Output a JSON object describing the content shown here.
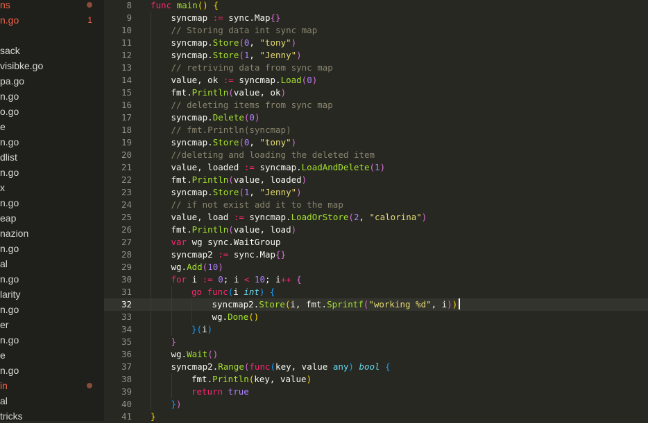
{
  "sidebar": {
    "items": [
      {
        "label": "ns"
      },
      {
        "label": "n.go",
        "badge": "1"
      },
      {
        "label": "sack"
      },
      {
        "label": "visibke.go"
      },
      {
        "label": "pa.go"
      },
      {
        "label": "n.go"
      },
      {
        "label": "o.go"
      },
      {
        "label": "e"
      },
      {
        "label": "n.go"
      },
      {
        "label": "dlist"
      },
      {
        "label": "n.go"
      },
      {
        "label": "x"
      },
      {
        "label": "n.go"
      },
      {
        "label": "eap"
      },
      {
        "label": "nazion"
      },
      {
        "label": "n.go"
      },
      {
        "label": "al"
      },
      {
        "label": "n.go"
      },
      {
        "label": "larity"
      },
      {
        "label": "n.go"
      },
      {
        "label": "er"
      },
      {
        "label": "n.go"
      },
      {
        "label": "e"
      },
      {
        "label": "n.go"
      },
      {
        "label": "in"
      },
      {
        "label": "al"
      },
      {
        "label": "tricks"
      }
    ]
  },
  "editor": {
    "current_line": 32,
    "lines": [
      {
        "n": "8",
        "indent": 0,
        "tokens": [
          [
            "kw",
            "func"
          ],
          [
            "",
            ""
          ],
          [
            "fn",
            " main"
          ],
          [
            "br1",
            "()"
          ],
          [
            "",
            ""
          ],
          [
            "br1",
            " {"
          ]
        ]
      },
      {
        "n": "9",
        "indent": 1,
        "tokens": [
          [
            "",
            "syncmap "
          ],
          [
            "op",
            ":="
          ],
          [
            "",
            " sync.Map"
          ],
          [
            "br2",
            "{}"
          ]
        ]
      },
      {
        "n": "10",
        "indent": 1,
        "tokens": [
          [
            "cm",
            "// Storing data int sync map"
          ]
        ]
      },
      {
        "n": "11",
        "indent": 1,
        "tokens": [
          [
            "",
            "syncmap."
          ],
          [
            "fn",
            "Store"
          ],
          [
            "br2",
            "("
          ],
          [
            "num",
            "0"
          ],
          [
            "",
            ", "
          ],
          [
            "str",
            "\"tony\""
          ],
          [
            "br2",
            ")"
          ]
        ]
      },
      {
        "n": "12",
        "indent": 1,
        "tokens": [
          [
            "",
            "syncmap."
          ],
          [
            "fn",
            "Store"
          ],
          [
            "br2",
            "("
          ],
          [
            "num",
            "1"
          ],
          [
            "",
            ", "
          ],
          [
            "str",
            "\"Jenny\""
          ],
          [
            "br2",
            ")"
          ]
        ]
      },
      {
        "n": "13",
        "indent": 1,
        "tokens": [
          [
            "cm",
            "// retriving data from sync map"
          ]
        ]
      },
      {
        "n": "14",
        "indent": 1,
        "tokens": [
          [
            "",
            "value, ok "
          ],
          [
            "op",
            ":="
          ],
          [
            "",
            " syncmap."
          ],
          [
            "fn",
            "Load"
          ],
          [
            "br2",
            "("
          ],
          [
            "num",
            "0"
          ],
          [
            "br2",
            ")"
          ]
        ]
      },
      {
        "n": "15",
        "indent": 1,
        "tokens": [
          [
            "",
            "fmt."
          ],
          [
            "fn",
            "Println"
          ],
          [
            "br2",
            "("
          ],
          [
            "",
            "value, ok"
          ],
          [
            "br2",
            ")"
          ]
        ]
      },
      {
        "n": "16",
        "indent": 1,
        "tokens": [
          [
            "cm",
            "// deleting items from sync map"
          ]
        ]
      },
      {
        "n": "17",
        "indent": 1,
        "tokens": [
          [
            "",
            "syncmap."
          ],
          [
            "fn",
            "Delete"
          ],
          [
            "br2",
            "("
          ],
          [
            "num",
            "0"
          ],
          [
            "br2",
            ")"
          ]
        ]
      },
      {
        "n": "18",
        "indent": 1,
        "tokens": [
          [
            "cm",
            "// fmt.Println(syncmap)"
          ]
        ]
      },
      {
        "n": "19",
        "indent": 1,
        "tokens": [
          [
            "",
            "syncmap."
          ],
          [
            "fn",
            "Store"
          ],
          [
            "br2",
            "("
          ],
          [
            "num",
            "0"
          ],
          [
            "",
            ", "
          ],
          [
            "str",
            "\"tony\""
          ],
          [
            "br2",
            ")"
          ]
        ]
      },
      {
        "n": "20",
        "indent": 1,
        "tokens": [
          [
            "cm",
            "//deleting and loading the deleted item"
          ]
        ]
      },
      {
        "n": "21",
        "indent": 1,
        "tokens": [
          [
            "",
            "value, loaded "
          ],
          [
            "op",
            ":="
          ],
          [
            "",
            " syncmap."
          ],
          [
            "fn",
            "LoadAndDelete"
          ],
          [
            "br2",
            "("
          ],
          [
            "num",
            "1"
          ],
          [
            "br2",
            ")"
          ]
        ]
      },
      {
        "n": "22",
        "indent": 1,
        "tokens": [
          [
            "",
            "fmt."
          ],
          [
            "fn",
            "Println"
          ],
          [
            "br2",
            "("
          ],
          [
            "",
            "value, loaded"
          ],
          [
            "br2",
            ")"
          ]
        ]
      },
      {
        "n": "23",
        "indent": 1,
        "tokens": [
          [
            "",
            "syncmap."
          ],
          [
            "fn",
            "Store"
          ],
          [
            "br2",
            "("
          ],
          [
            "num",
            "1"
          ],
          [
            "",
            ", "
          ],
          [
            "str",
            "\"Jenny\""
          ],
          [
            "br2",
            ")"
          ]
        ]
      },
      {
        "n": "24",
        "indent": 1,
        "tokens": [
          [
            "cm",
            "// if not exist add it to the map"
          ]
        ]
      },
      {
        "n": "25",
        "indent": 1,
        "tokens": [
          [
            "",
            "value, load "
          ],
          [
            "op",
            ":="
          ],
          [
            "",
            " syncmap."
          ],
          [
            "fn",
            "LoadOrStore"
          ],
          [
            "br2",
            "("
          ],
          [
            "num",
            "2"
          ],
          [
            "",
            ", "
          ],
          [
            "str",
            "\"calorina\""
          ],
          [
            "br2",
            ")"
          ]
        ]
      },
      {
        "n": "26",
        "indent": 1,
        "tokens": [
          [
            "",
            "fmt."
          ],
          [
            "fn",
            "Println"
          ],
          [
            "br2",
            "("
          ],
          [
            "",
            "value, load"
          ],
          [
            "br2",
            ")"
          ]
        ]
      },
      {
        "n": "27",
        "indent": 1,
        "tokens": [
          [
            "kw",
            "var"
          ],
          [
            "",
            " wg sync.WaitGroup"
          ]
        ]
      },
      {
        "n": "28",
        "indent": 1,
        "tokens": [
          [
            "",
            "syncmap2 "
          ],
          [
            "op",
            ":="
          ],
          [
            "",
            " sync.Map"
          ],
          [
            "br2",
            "{}"
          ]
        ]
      },
      {
        "n": "29",
        "indent": 1,
        "tokens": [
          [
            "",
            "wg."
          ],
          [
            "fn",
            "Add"
          ],
          [
            "br2",
            "("
          ],
          [
            "num",
            "10"
          ],
          [
            "br2",
            ")"
          ]
        ]
      },
      {
        "n": "30",
        "indent": 1,
        "tokens": [
          [
            "kw",
            "for"
          ],
          [
            "",
            " i "
          ],
          [
            "op",
            ":="
          ],
          [
            "",
            " "
          ],
          [
            "num",
            "0"
          ],
          [
            "",
            "; i "
          ],
          [
            "op",
            "<"
          ],
          [
            "",
            " "
          ],
          [
            "num",
            "10"
          ],
          [
            "",
            "; i"
          ],
          [
            "op",
            "++"
          ],
          [
            "br2",
            " {"
          ]
        ]
      },
      {
        "n": "31",
        "indent": 2,
        "tokens": [
          [
            "kw",
            "go"
          ],
          [
            "kw",
            " func"
          ],
          [
            "br3",
            "("
          ],
          [
            "",
            "i "
          ],
          [
            "typ it",
            "int"
          ],
          [
            "br3",
            ")"
          ],
          [
            "br3",
            " {"
          ]
        ]
      },
      {
        "n": "32",
        "indent": 3,
        "tokens": [
          [
            "",
            "syncmap2."
          ],
          [
            "fn",
            "Store"
          ],
          [
            "br1",
            "("
          ],
          [
            "",
            "i, fmt."
          ],
          [
            "fn",
            "Sprintf"
          ],
          [
            "br2",
            "("
          ],
          [
            "str",
            "\"working %d\""
          ],
          [
            "",
            ", i"
          ],
          [
            "br2",
            ")"
          ],
          [
            "br1",
            ")"
          ]
        ]
      },
      {
        "n": "33",
        "indent": 3,
        "tokens": [
          [
            "",
            "wg."
          ],
          [
            "fn",
            "Done"
          ],
          [
            "br1",
            "()"
          ]
        ]
      },
      {
        "n": "34",
        "indent": 2,
        "tokens": [
          [
            "br3",
            "}"
          ],
          [
            "br3",
            "("
          ],
          [
            "",
            "i"
          ],
          [
            "br3",
            ")"
          ]
        ]
      },
      {
        "n": "35",
        "indent": 1,
        "tokens": [
          [
            "br2",
            "}"
          ]
        ]
      },
      {
        "n": "36",
        "indent": 1,
        "tokens": [
          [
            "",
            "wg."
          ],
          [
            "fn",
            "Wait"
          ],
          [
            "br2",
            "()"
          ]
        ]
      },
      {
        "n": "37",
        "indent": 1,
        "tokens": [
          [
            "",
            "syncmap2."
          ],
          [
            "fn",
            "Range"
          ],
          [
            "br2",
            "("
          ],
          [
            "kw",
            "func"
          ],
          [
            "br3",
            "("
          ],
          [
            "",
            "key, value "
          ],
          [
            "typ",
            "any"
          ],
          [
            "br3",
            ")"
          ],
          [
            "",
            ""
          ],
          [
            "typ it",
            " bool"
          ],
          [
            "br3",
            " {"
          ]
        ]
      },
      {
        "n": "38",
        "indent": 2,
        "tokens": [
          [
            "",
            "fmt."
          ],
          [
            "fn",
            "Println"
          ],
          [
            "br1",
            "("
          ],
          [
            "",
            "key, value"
          ],
          [
            "br1",
            ")"
          ]
        ]
      },
      {
        "n": "39",
        "indent": 2,
        "tokens": [
          [
            "kw",
            "return"
          ],
          [
            "num",
            " true"
          ]
        ]
      },
      {
        "n": "40",
        "indent": 1,
        "tokens": [
          [
            "br3",
            "}"
          ],
          [
            "br2",
            ")"
          ]
        ]
      },
      {
        "n": "41",
        "indent": 0,
        "tokens": [
          [
            "br1",
            "}"
          ]
        ]
      }
    ]
  }
}
